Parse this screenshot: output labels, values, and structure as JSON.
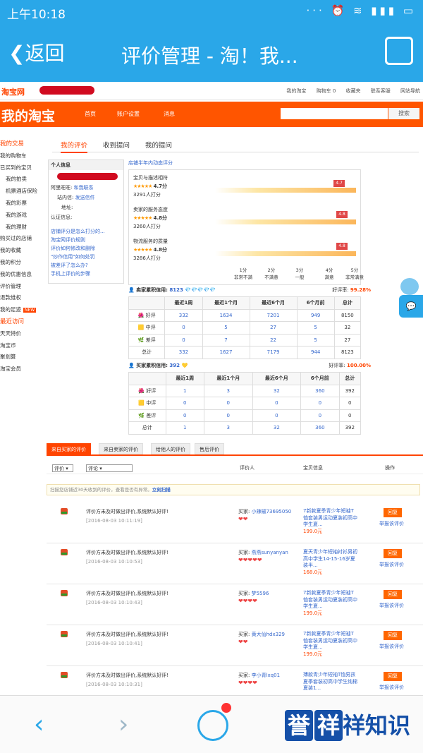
{
  "status": {
    "time": "上午10:18",
    "icons": "··· ⏰ ≋ ▮▮▮ ▭"
  },
  "nav": {
    "back": "返回",
    "title": "评价管理 - 淘！我...",
    "share_icon": "share-icon"
  },
  "site": {
    "logo": "淘宝网",
    "toplinks": [
      "我的淘宝",
      "购物车 0",
      "收藏夹",
      "联系客服",
      "网站导航"
    ],
    "brand": "我的淘宝",
    "orange_nav": [
      "首页",
      "账户设置",
      "消息"
    ],
    "search_btn": "搜索",
    "sidebar": {
      "sec1": "我的交易",
      "items1": [
        "我的购物车",
        "已买到的宝贝",
        "我的拍卖",
        "机票酒店保险",
        "我的彩票",
        "我的游戏",
        "我的理财",
        "购买过的店铺",
        "我的收藏",
        "我的积分",
        "我的优惠信息",
        "评价管理",
        "退款维权",
        "我的足迹"
      ],
      "new_badge": "NEW",
      "sec2": "最近访问",
      "items2": [
        "天天特价",
        "淘宝币",
        "聚划算",
        "淘宝会员"
      ]
    },
    "tabs": [
      "我的评价",
      "收到提问",
      "我的提问"
    ],
    "info": {
      "title": "个人信息",
      "wangwang_label": "阿里旺旺:",
      "wangwang_status": "和我联系",
      "mail_label": "站内信:",
      "mail_link": "发送信件",
      "addr_label": "地址:",
      "auth_label": "认证信息:",
      "links": [
        "店铺评分是怎么打分的...",
        "淘宝网评价规则",
        "评价如何修改和删除",
        "\"炒作信用\"如何处罚",
        "被差评了怎么办?",
        "手机上评价的步骤"
      ]
    },
    "dsr": {
      "title": "店铺半年内动态评分",
      "items": [
        {
          "label": "宝贝与描述相符",
          "score": "4.7分",
          "count": "3291人打分",
          "flag": "4.7",
          "pct": 0.94
        },
        {
          "label": "卖家的服务态度",
          "score": "4.8分",
          "count": "3260人打分",
          "flag": "4.8",
          "pct": 0.96
        },
        {
          "label": "物流服务的质量",
          "score": "4.8分",
          "count": "3286人打分",
          "flag": "4.8",
          "pct": 0.96
        }
      ],
      "scale": [
        {
          "a": "1分",
          "b": "非常不满"
        },
        {
          "a": "2分",
          "b": "不满意"
        },
        {
          "a": "3分",
          "b": "一般"
        },
        {
          "a": "4分",
          "b": "满意"
        },
        {
          "a": "5分",
          "b": "非常满意"
        }
      ]
    },
    "seller_credit": {
      "label": "卖家累积信用:",
      "value": "8123",
      "rate_label": "好评率:",
      "rate": "99.28%"
    },
    "buyer_credit": {
      "label": "买家累积信用:",
      "value": "392",
      "rate_label": "好评率:",
      "rate": "100.00%"
    },
    "credit_headers": [
      "",
      "最近1周",
      "最近1个月",
      "最近6个月",
      "6个月前",
      "总计"
    ],
    "row_labels": [
      "好评",
      "中评",
      "差评",
      "总计"
    ],
    "seller_rows": [
      [
        "332",
        "1634",
        "7201",
        "949",
        "8150"
      ],
      [
        "0",
        "5",
        "27",
        "5",
        "32"
      ],
      [
        "0",
        "7",
        "22",
        "5",
        "27"
      ],
      [
        "332",
        "1627",
        "7179",
        "944",
        "8123"
      ]
    ],
    "buyer_rows": [
      [
        "1",
        "3",
        "32",
        "360",
        "392"
      ],
      [
        "0",
        "0",
        "0",
        "0",
        "0"
      ],
      [
        "0",
        "0",
        "0",
        "0",
        "0"
      ],
      [
        "1",
        "3",
        "32",
        "360",
        "392"
      ]
    ],
    "tabs2": [
      "来自买家的评价",
      "来自卖家的评价",
      "给他人的评价",
      "售后评价"
    ],
    "filter": {
      "sel1": "评价",
      "sel2": "评论",
      "col_reviewer": "评价人",
      "col_item": "宝贝信息",
      "col_op": "操作"
    },
    "notice": {
      "text": "扫描您店铺近30天收到的评价，查看是否有异常。",
      "link": "立刻扫描"
    },
    "reviews": [
      {
        "text": "评价方未及时做出评价,系统默认好评!",
        "date": "[2016-08-03 10:11:19]",
        "buyer_label": "买家:",
        "buyer": "小辣椒73695050",
        "hearts": "❤❤",
        "item": "7新款夏季青少年短袖T恤套装男运动夏装初高中学生夏...",
        "price": "199.0元",
        "reply": "回复",
        "report": "举报该评价"
      },
      {
        "text": "评价方未及时做出评价,系统默认好评!",
        "date": "[2016-08-03 10:10:53]",
        "buyer_label": "买家:",
        "buyer": "燕燕sunyanyan",
        "hearts": "❤❤❤❤❤",
        "item": "夏天青少年短袖衬衫男初高中学生14-15-16岁夏装半...",
        "price": "168.0元",
        "reply": "回复",
        "report": "举报该评价"
      },
      {
        "text": "评价方未及时做出评价,系统默认好评!",
        "date": "[2016-08-03 10:10:43]",
        "buyer_label": "买家:",
        "buyer": "梦5596",
        "hearts": "❤❤❤❤",
        "item": "7新款夏季青少年短袖T恤套装男运动夏装初高中学生夏...",
        "price": "199.0元",
        "reply": "回复",
        "report": "举报该评价"
      },
      {
        "text": "评价方未及时做出评价,系统默认好评!",
        "date": "[2016-08-03 10:10:41]",
        "buyer_label": "买家:",
        "buyer": "黄大仙hdx329",
        "hearts": "❤❤",
        "item": "7新款夏季青少年短袖T恤套装男运动夏装初高中学生夏...",
        "price": "199.0元",
        "reply": "回复",
        "report": "举报该评价"
      },
      {
        "text": "评价方未及时做出评价,系统默认好评!",
        "date": "[2016-08-03 10:10:31]",
        "buyer_label": "买家:",
        "buyer": "李小青lxq01",
        "hearts": "❤❤❤❤",
        "item": "薄款青少年短袖T恤男孩夏季套装初高中学生纯棉夏装1...",
        "price": "",
        "reply": "回复",
        "report": "举报该评价"
      }
    ]
  },
  "watermark": {
    "a": "誉",
    "b": "祥",
    "c": "祥知识"
  }
}
